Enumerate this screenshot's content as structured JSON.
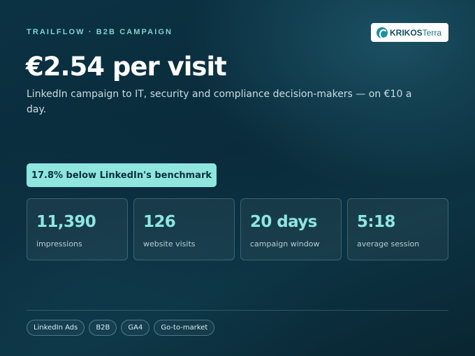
{
  "header": {
    "eyebrow": "TRAILFLOW · B2B CAMPAIGN",
    "logo": {
      "brand": "KRIKOS",
      "suffix": "Terra"
    }
  },
  "hero": {
    "headline": "€2.54 per visit",
    "subtitle": "LinkedIn campaign to IT, security and compliance decision-makers — on €10 a day."
  },
  "benchmark_badge": "17.8% below LinkedIn's benchmark",
  "stats": [
    {
      "value": "11,390",
      "label": "impressions"
    },
    {
      "value": "126",
      "label": "website visits"
    },
    {
      "value": "20 days",
      "label": "campaign window"
    },
    {
      "value": "5:18",
      "label": "average session"
    }
  ],
  "tags": [
    "LinkedIn Ads",
    "B2B",
    "GA4",
    "Go-to-market"
  ],
  "colors": {
    "accent": "#8ee6df",
    "eyebrow": "#7fd0d5",
    "background": "#0b3243"
  }
}
